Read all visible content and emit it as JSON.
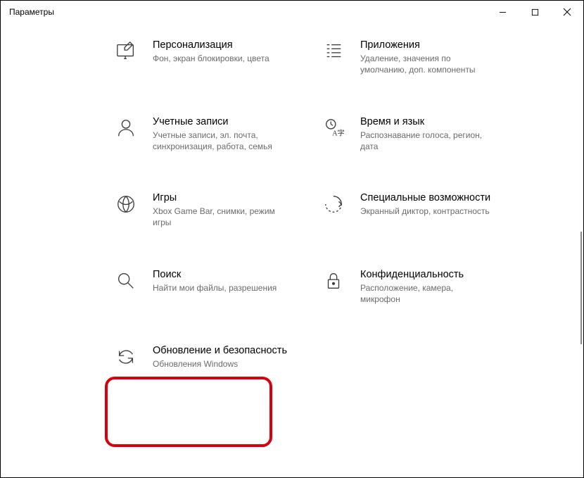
{
  "window": {
    "title": "Параметры"
  },
  "tiles": {
    "personalization": {
      "title": "Персонализация",
      "desc": "Фон, экран блокировки, цвета"
    },
    "apps": {
      "title": "Приложения",
      "desc": "Удаление, значения по умолчанию, доп. компоненты"
    },
    "accounts": {
      "title": "Учетные записи",
      "desc": "Учетные записи, эл. почта, синхронизация, работа, семья"
    },
    "timeLanguage": {
      "title": "Время и язык",
      "desc": "Распознавание голоса, регион, дата"
    },
    "gaming": {
      "title": "Игры",
      "desc": "Xbox Game Bar, снимки, режим игры"
    },
    "accessibility": {
      "title": "Специальные возможности",
      "desc": "Экранный диктор, контрастность"
    },
    "search": {
      "title": "Поиск",
      "desc": "Найти мои файлы, разрешения"
    },
    "privacy": {
      "title": "Конфиденциальность",
      "desc": "Расположение, камера, микрофон"
    },
    "update": {
      "title": "Обновление и безопасность",
      "desc": "Обновления Windows"
    }
  }
}
